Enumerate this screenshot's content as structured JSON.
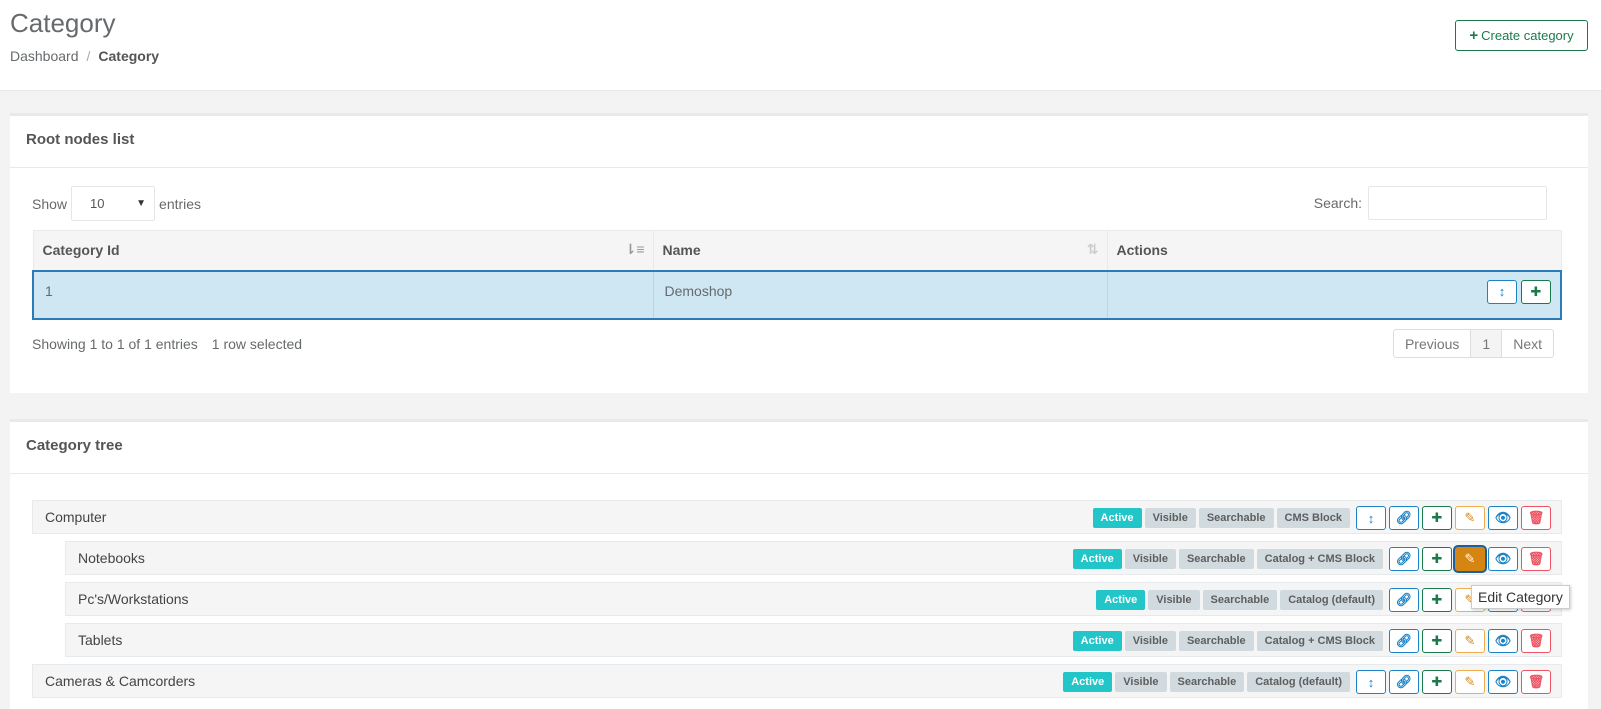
{
  "header": {
    "title": "Category",
    "breadcrumb": {
      "home": "Dashboard",
      "separator": "/",
      "current": "Category"
    },
    "create_button": {
      "icon": "+",
      "label": "Create category"
    }
  },
  "root_nodes": {
    "title": "Root nodes list",
    "length": {
      "prefix": "Show",
      "value": "10",
      "suffix": "entries"
    },
    "search_label": "Search:",
    "columns": [
      "Category Id",
      "Name",
      "Actions"
    ],
    "rows": [
      {
        "id": "1",
        "name": "Demoshop"
      }
    ],
    "info": "Showing 1 to 1 of 1 entries",
    "selected_info": "1 row selected",
    "pagination": {
      "previous": "Previous",
      "page": "1",
      "next": "Next"
    }
  },
  "category_tree": {
    "title": "Category tree",
    "nodes": [
      {
        "name": "Computer",
        "badges": [
          "Active",
          "Visible",
          "Searchable",
          "CMS Block"
        ]
      },
      {
        "name": "Notebooks",
        "badges": [
          "Active",
          "Visible",
          "Searchable",
          "Catalog + CMS Block"
        ]
      },
      {
        "name": "Pc's/Workstations",
        "badges": [
          "Active",
          "Visible",
          "Searchable",
          "Catalog (default)"
        ]
      },
      {
        "name": "Tablets",
        "badges": [
          "Active",
          "Visible",
          "Searchable",
          "Catalog + CMS Block"
        ]
      },
      {
        "name": "Cameras & Camcorders",
        "badges": [
          "Active",
          "Visible",
          "Searchable",
          "Catalog (default)"
        ]
      }
    ]
  },
  "tooltip": "Edit Category",
  "colors": {
    "active_badge": "#23c6c8",
    "primary_green": "#1a7a4c",
    "primary_blue": "#1c84c6",
    "warning_orange": "#d58512",
    "danger_red": "#ed5565"
  }
}
